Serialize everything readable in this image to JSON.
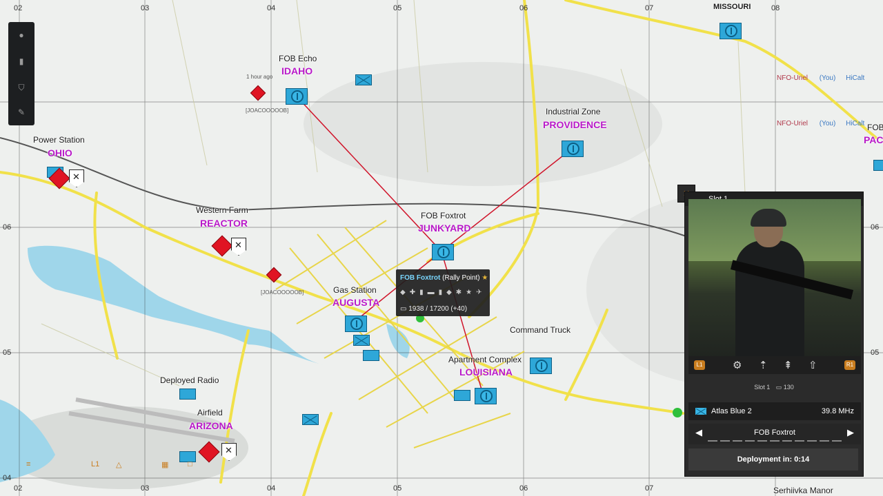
{
  "grid": {
    "top": [
      "02",
      "03",
      "04",
      "05",
      "06",
      "07",
      "08"
    ],
    "right": [
      "06",
      "05"
    ],
    "left": [
      "06",
      "05",
      "04"
    ],
    "bottom": [
      "02",
      "03",
      "04",
      "05",
      "06",
      "07"
    ]
  },
  "map_labels": {
    "missouri": "MISSOURI",
    "fob_echo": "FOB Echo",
    "idaho": "IDAHO",
    "industrial_zone": "Industrial Zone",
    "providence": "PROVIDENCE",
    "power_station": "Power Station",
    "ohio": "OHIO",
    "western_farm": "Western Farm",
    "reactor": "REACTOR",
    "fob_foxtrot": "FOB Foxtrot",
    "junkyard": "JUNKYARD",
    "gas_station": "Gas Station",
    "augusta": "AUGUSTA",
    "command_truck": "Command Truck",
    "apartment_complex": "Apartment Complex",
    "louisiana": "LOUISIANA",
    "deployed_radio": "Deployed Radio",
    "airfield": "Airfield",
    "arizona": "ARIZONA",
    "serhiivka": "Serhiivka Manor",
    "fob_partial": "FOB",
    "pac_partial": "PAC",
    "one_hour_ago": "1 hour ago",
    "code_a": "[JOACOOOOOB]",
    "code_b": "[JOACOOOOOB]"
  },
  "players": {
    "p1_name": "NFO-Uriel",
    "p1_you": "(You)",
    "p1_tag": "HiCalt",
    "p2_name": "NFO-Uriel",
    "p2_you": "(You)",
    "p2_tag": "HiCalt"
  },
  "tooltip": {
    "title": "FOB Foxtrot",
    "subtitle": "(Rally Point)",
    "star": "★",
    "supplies": "1938 / 17200 (+40)"
  },
  "panel": {
    "slot_title": "Slot 1",
    "l1": "L1",
    "r1": "R1",
    "slot_info_label": "Slot 1",
    "slot_info_value": "130",
    "squad_name": "Atlas Blue 2",
    "frequency": "39.8 MHz",
    "spawn_point": "FOB Foxtrot",
    "prev_arrow": "◀",
    "next_arrow": "▶",
    "deploy_text": "Deployment in: 0:14"
  },
  "colors": {
    "friendly": "#2ea7d8",
    "enemy": "#e01423",
    "objective": "#b818c8",
    "route": "#d0142a",
    "road": "#f1e14a"
  }
}
